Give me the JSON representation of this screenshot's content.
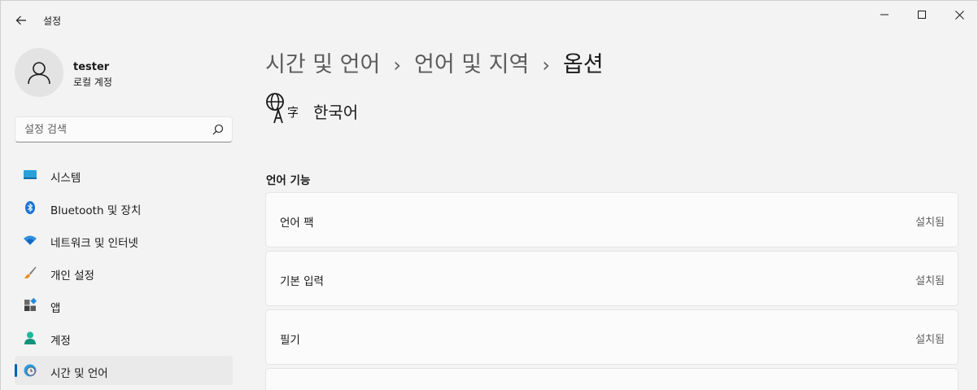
{
  "window": {
    "title": "설정",
    "back_icon": "back-arrow-icon",
    "controls": [
      "minimize-icon",
      "maximize-icon",
      "close-icon"
    ]
  },
  "profile": {
    "name": "tester",
    "account_type": "로컬 계정"
  },
  "search": {
    "placeholder": "설정 검색"
  },
  "sidebar": {
    "items": [
      {
        "label": "시스템",
        "icon": "monitor-icon",
        "active": false
      },
      {
        "label": "Bluetooth 및 장치",
        "icon": "bluetooth-icon",
        "active": false
      },
      {
        "label": "네트워크 및 인터넷",
        "icon": "wifi-icon",
        "active": false
      },
      {
        "label": "개인 설정",
        "icon": "paintbrush-icon",
        "active": false
      },
      {
        "label": "앱",
        "icon": "apps-icon",
        "active": false
      },
      {
        "label": "계정",
        "icon": "person-icon",
        "active": false
      },
      {
        "label": "시간 및 언어",
        "icon": "globe-clock-icon",
        "active": true
      }
    ]
  },
  "breadcrumb": {
    "items": [
      "시간 및 언어",
      "언어 및 지역",
      "옵션"
    ],
    "separator": "›"
  },
  "language": {
    "name": "한국어",
    "icon": "language-icon"
  },
  "features": {
    "title": "언어 기능",
    "rows": [
      {
        "label": "언어 팩",
        "status": "설치됨"
      },
      {
        "label": "기본 입력",
        "status": "설치됨"
      },
      {
        "label": "필기",
        "status": "설치됨"
      }
    ]
  },
  "colors": {
    "accent": "#005fb8",
    "background": "#f3f3f3",
    "card": "#fbfbfb"
  }
}
